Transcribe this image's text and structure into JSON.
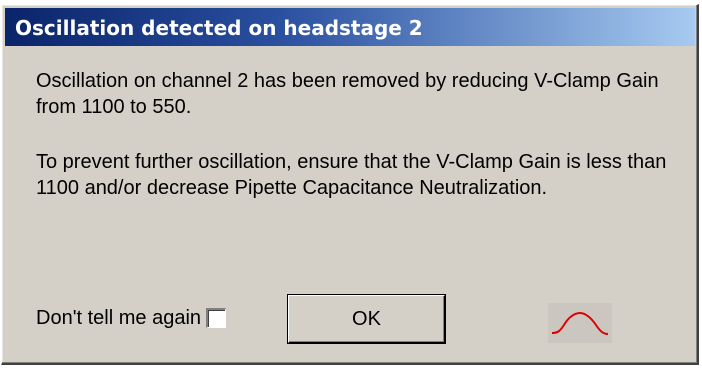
{
  "dialog": {
    "title": "Oscillation detected on headstage 2",
    "message_line1": "Oscillation on channel 2 has been removed by reducing V-Clamp Gain from 1100 to 550.",
    "message_line2": "To prevent further oscillation, ensure that the V-Clamp Gain is less than 1100 and/or decrease Pipette Capacitance Neutralization.",
    "dont_tell_label": "Don't tell me again",
    "dont_tell_checked": false,
    "ok_label": "OK",
    "icon": "oscillation-waveform-icon",
    "colors": {
      "titlebar_start": "#0a246a",
      "titlebar_end": "#a6caf0",
      "face": "#d4d0c8",
      "waveform": "#e00000"
    }
  }
}
